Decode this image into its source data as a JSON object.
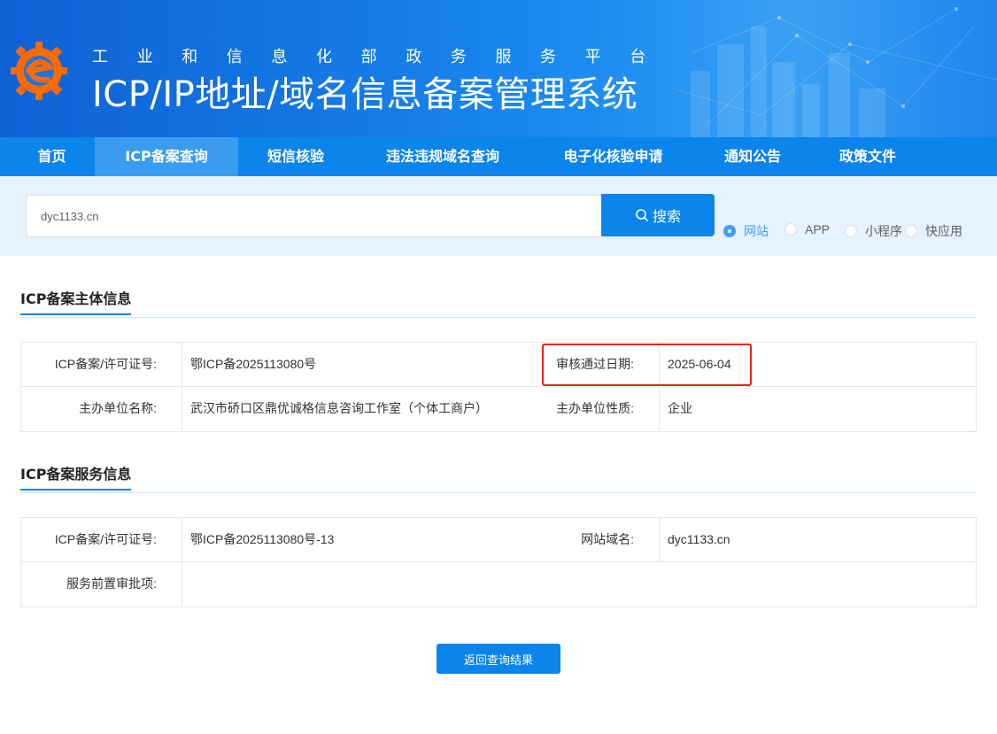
{
  "header": {
    "subtitle": "工业和信息化部政务服务平台",
    "title": "ICP/IP地址/域名信息备案管理系统"
  },
  "nav": {
    "items": [
      {
        "label": "首页"
      },
      {
        "label": "ICP备案查询",
        "active": true
      },
      {
        "label": "短信核验"
      },
      {
        "label": "违法违规域名查询"
      },
      {
        "label": "电子化核验申请"
      },
      {
        "label": "通知公告"
      },
      {
        "label": "政策文件"
      }
    ]
  },
  "search": {
    "value": "dyc1133.cn",
    "button_label": "搜索",
    "options": [
      {
        "label": "网站",
        "checked": true
      },
      {
        "label": "APP",
        "checked": false
      },
      {
        "label": "小程序",
        "checked": false
      },
      {
        "label": "快应用",
        "checked": false
      }
    ]
  },
  "subject": {
    "section_title": "ICP备案主体信息",
    "license_label": "ICP备案/许可证号:",
    "license_value": "鄂ICP备2025113080号",
    "approve_date_label": "审核通过日期:",
    "approve_date_value": "2025-06-04",
    "org_name_label": "主办单位名称:",
    "org_name_value": "武汉市硚口区鼎优诚格信息咨询工作室（个体工商户）",
    "org_type_label": "主办单位性质:",
    "org_type_value": "企业"
  },
  "service": {
    "section_title": "ICP备案服务信息",
    "license_label": "ICP备案/许可证号:",
    "license_value": "鄂ICP备2025113080号-13",
    "domain_label": "网站域名:",
    "domain_value": "dyc1133.cn",
    "pre_approval_label": "服务前置审批项:",
    "pre_approval_value": ""
  },
  "back_button_label": "返回查询结果",
  "colors": {
    "nav_bg": "#0b84ec",
    "nav_active": "#3a9cf0",
    "highlight_border": "#e8211d",
    "radio_checked": "#409eff"
  }
}
